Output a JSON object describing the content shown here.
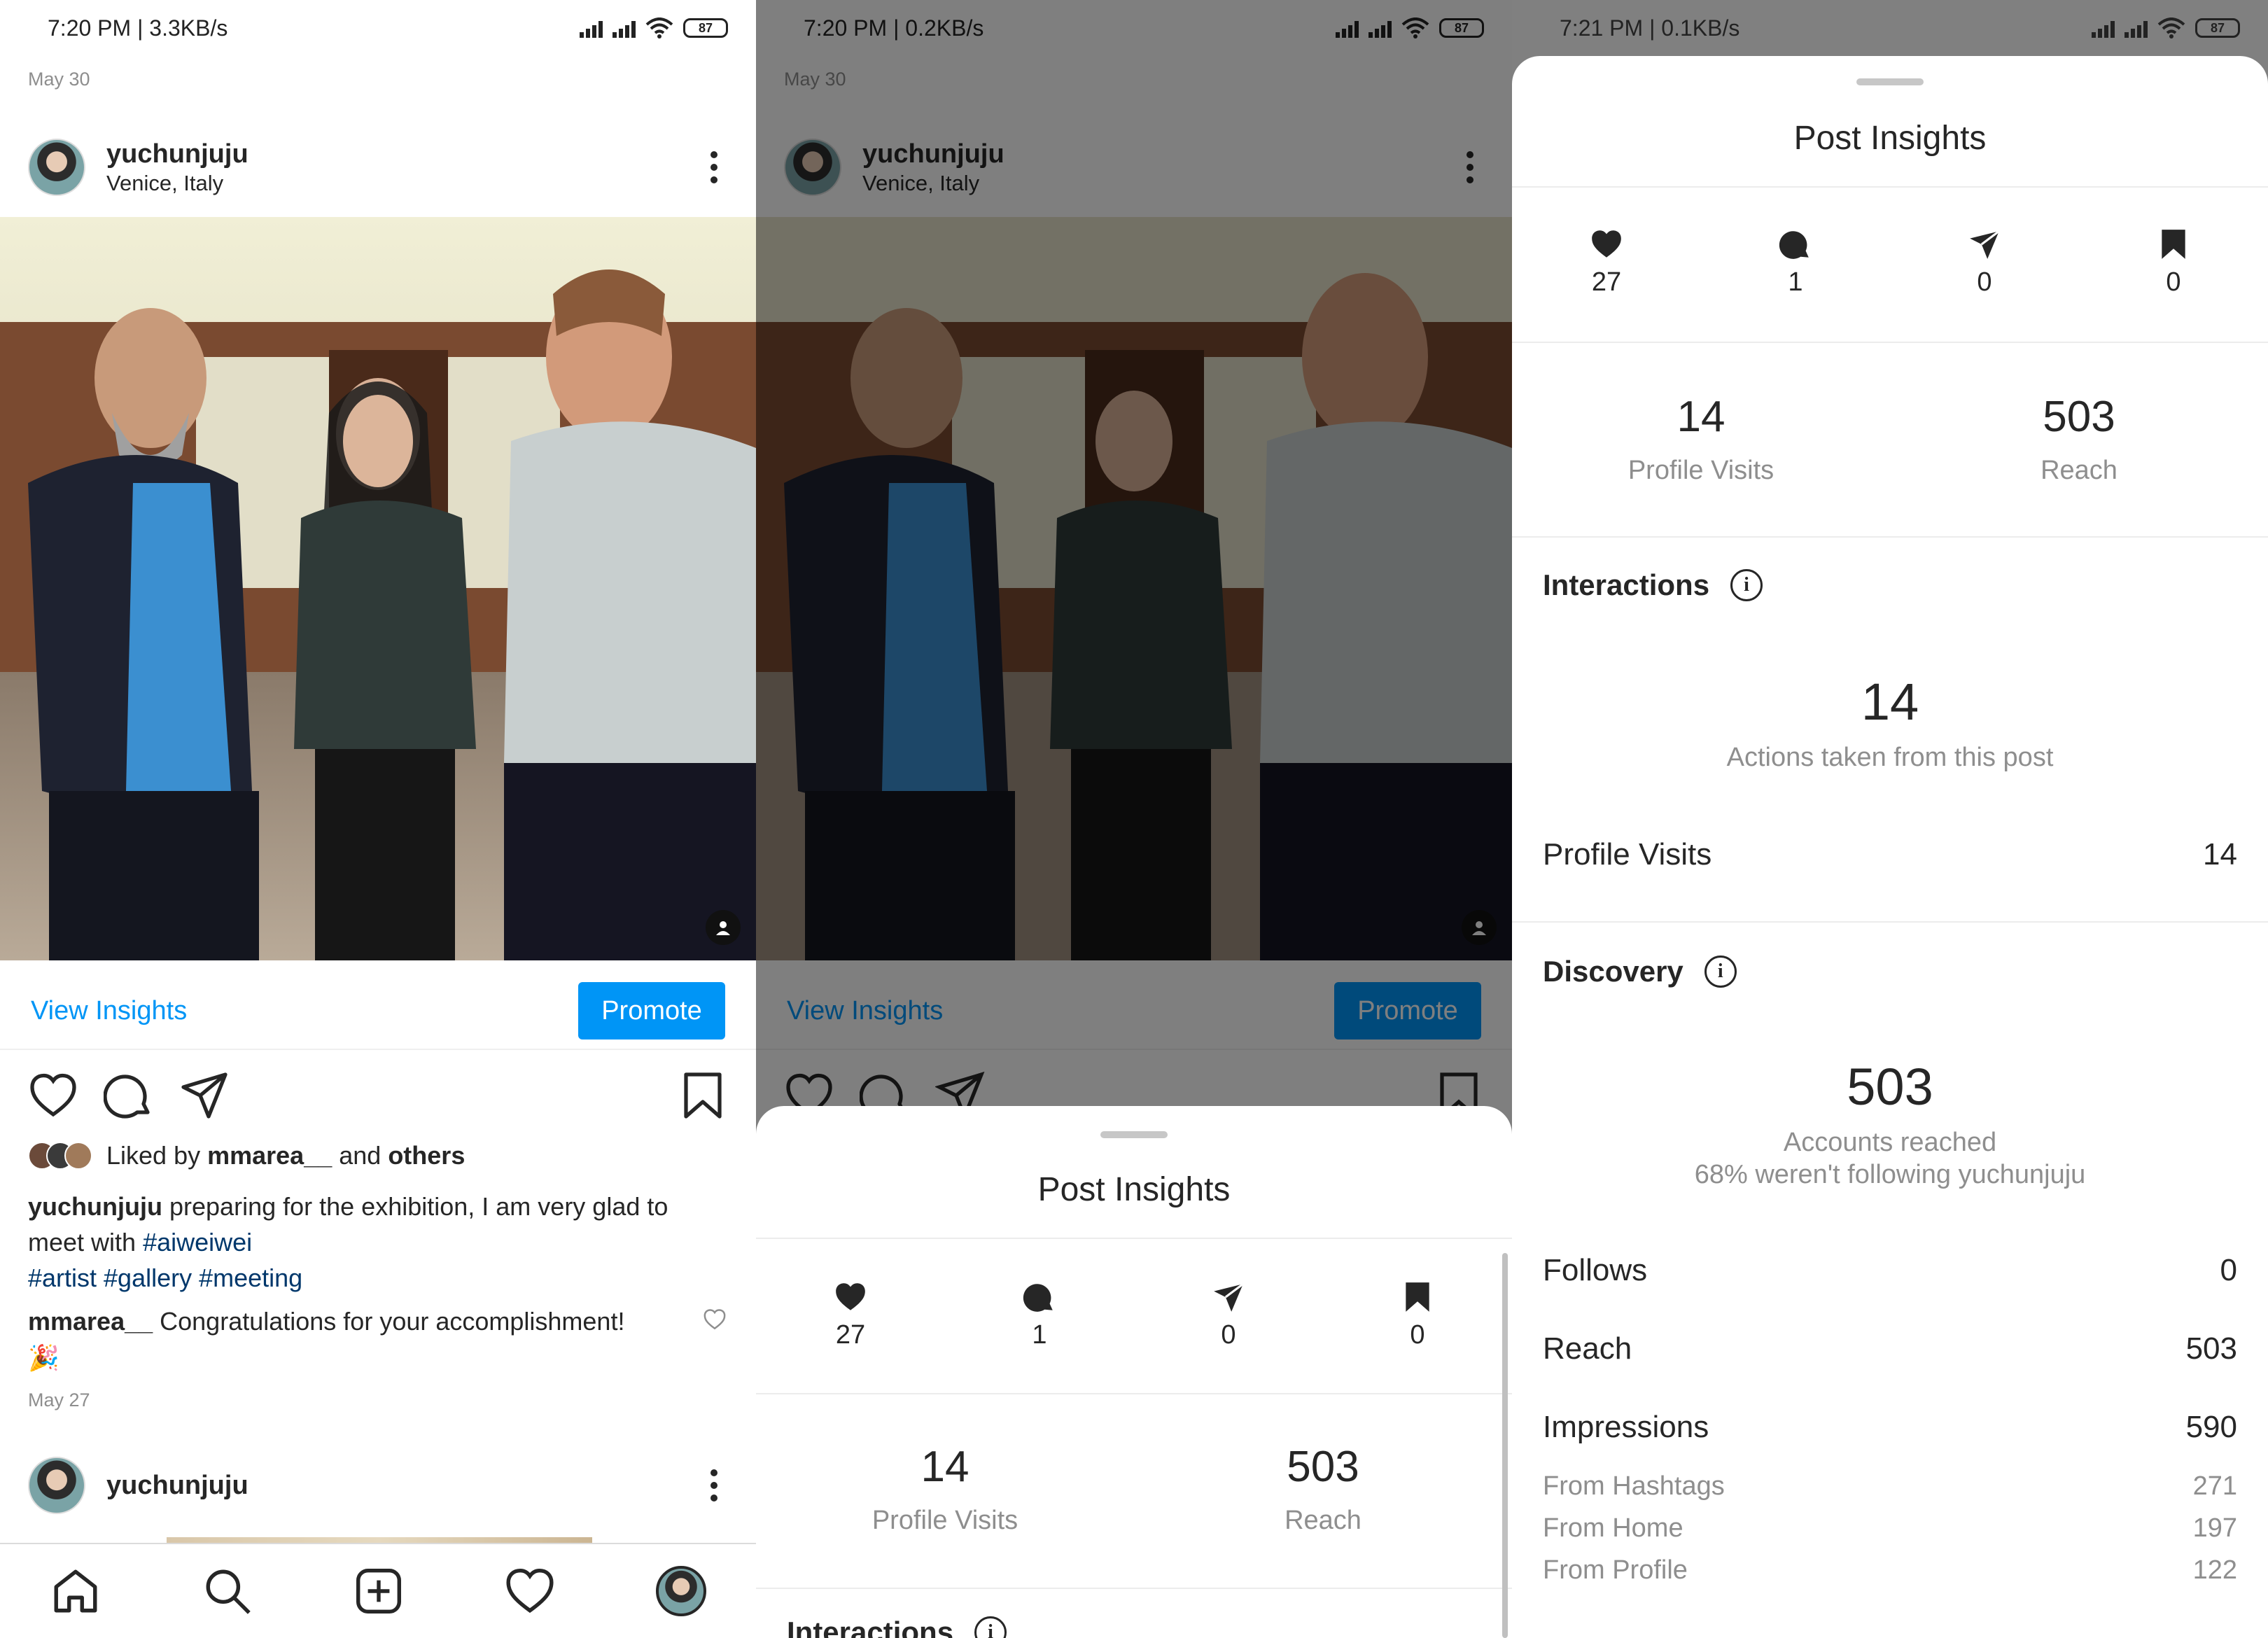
{
  "statusbars": [
    {
      "time": "7:20 PM | 3.3KB/s",
      "battery": "87"
    },
    {
      "time": "7:20 PM | 0.2KB/s",
      "battery": "87"
    },
    {
      "time": "7:21 PM | 0.1KB/s",
      "battery": "87"
    }
  ],
  "feed": {
    "date1": "May 30",
    "post1": {
      "username": "yuchunjuju",
      "location": "Venice, Italy"
    },
    "view_insights": "View Insights",
    "promote": "Promote",
    "liked_prefix": "Liked by ",
    "liked_user": "mmarea__",
    "liked_and": " and ",
    "liked_others": "others",
    "caption_user": "yuchunjuju",
    "caption_text": " preparing for the exhibition, I am very glad to meet with ",
    "caption_tag1": "#aiweiwei",
    "caption_tags": "#artist #gallery #meeting",
    "comment_user": "mmarea__",
    "comment_text": " Congratulations for your accomplishment!",
    "comment_emoji": "🎉",
    "date2": "May 27",
    "post2": {
      "username": "yuchunjuju"
    }
  },
  "insights": {
    "title": "Post Insights",
    "likes": "27",
    "comments": "1",
    "shares": "0",
    "saves": "0",
    "profile_visits_num": "14",
    "profile_visits_label": "Profile Visits",
    "reach_num": "503",
    "reach_label": "Reach",
    "interactions_title": "Interactions",
    "interactions_num": "14",
    "interactions_label": "Actions taken from this post",
    "profile_visits_row_label": "Profile Visits",
    "profile_visits_row_value": "14",
    "discovery_title": "Discovery",
    "discovery_num": "503",
    "discovery_label": "Accounts reached",
    "discovery_sub": "68% weren't following yuchunjuju",
    "follows_label": "Follows",
    "follows_value": "0",
    "reach_row_label": "Reach",
    "reach_row_value": "503",
    "impressions_label": "Impressions",
    "impressions_value": "590",
    "from_hashtags_label": "From Hashtags",
    "from_hashtags_value": "271",
    "from_home_label": "From Home",
    "from_home_value": "197",
    "from_profile_label": "From Profile",
    "from_profile_value": "122",
    "interactions_peek": "Interactions"
  },
  "colors": {
    "accent": "#0095f6",
    "hashtag": "#00376b",
    "muted": "#8e8e8e"
  }
}
